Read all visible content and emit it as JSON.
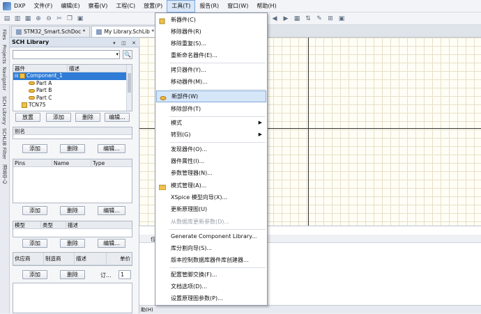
{
  "menubar": {
    "logo": "DXP",
    "items": [
      "文件(F)",
      "编辑(E)",
      "察看(V)",
      "工程(C)",
      "放置(P)",
      "工具(T)",
      "报告(R)",
      "窗口(W)",
      "帮助(H)"
    ]
  },
  "tabs": {
    "doc1": "STM32_Smart.SchDoc *",
    "doc2": "My Library.SchLib *"
  },
  "side_tabs": [
    "Files",
    "Projects",
    "Navigator",
    "SCH Library",
    "SCHLIB Filter",
    "消息中心"
  ],
  "panel": {
    "title": "SCH Library",
    "search_button": "🔍",
    "components_header": [
      "器件",
      "描述"
    ],
    "tree": [
      {
        "label": "Component_1",
        "level": 0
      },
      {
        "label": "Part A",
        "level": 1
      },
      {
        "label": "Part B",
        "level": 1
      },
      {
        "label": "Part C",
        "level": 1
      },
      {
        "label": "TCN75",
        "level": 0
      }
    ],
    "comp_buttons": [
      "放置",
      "添加",
      "删除",
      "编辑..."
    ],
    "alias_header": "别名",
    "alias_buttons": [
      "添加",
      "删除",
      "编辑..."
    ],
    "pins_header": [
      "Pins",
      "Name",
      "Type"
    ],
    "pins_buttons": [
      "添加",
      "删除",
      "编辑..."
    ],
    "model_header": [
      "模型",
      "类型",
      "描述"
    ],
    "model_buttons": [
      "添加",
      "删除",
      "编辑..."
    ],
    "supplier_header": [
      "供应商",
      "制造商",
      "描述",
      "单价"
    ],
    "supplier_buttons": [
      "添加",
      "删除"
    ],
    "order_label": "订...",
    "order_value": "1"
  },
  "bottom": {
    "header_fragment": "位",
    "status_fragment": "助(H)"
  },
  "tools_menu": {
    "items": [
      {
        "label": "新器件(C)",
        "icon": true
      },
      {
        "label": "移除器件(R)"
      },
      {
        "label": "移除重复(S)..."
      },
      {
        "label": "重新命名器件(E)..."
      },
      {
        "label": "拷贝器件(Y)..."
      },
      {
        "label": "移动器件(M)..."
      },
      {
        "label": "新部件(W)",
        "icon": true,
        "hover": true
      },
      {
        "label": "移除部件(T)"
      },
      {
        "label": "模式",
        "submenu": true
      },
      {
        "label": "转到(G)",
        "submenu": true
      },
      {
        "label": "发现器件(O)..."
      },
      {
        "label": "器件属性(I)..."
      },
      {
        "label": "参数管理器(N)..."
      },
      {
        "label": "模式管理(A)...",
        "icon": true
      },
      {
        "label": "XSpice 模型向导(X)..."
      },
      {
        "label": "更新原理图(U)"
      },
      {
        "label": "从数据库更新参数(D)...",
        "disabled": true
      },
      {
        "label": "Generate Component Library..."
      },
      {
        "label": "库分割向导(S)..."
      },
      {
        "label": "版本控制数据库器件库创建器..."
      },
      {
        "label": "配置管脚交换(F)..."
      },
      {
        "label": "文档选项(D)..."
      },
      {
        "label": "设置原理图参数(P)..."
      }
    ]
  },
  "colors": {
    "selected": "#2f7bd6",
    "hover": "#d6e6f9",
    "canvas": "#fffef6"
  }
}
